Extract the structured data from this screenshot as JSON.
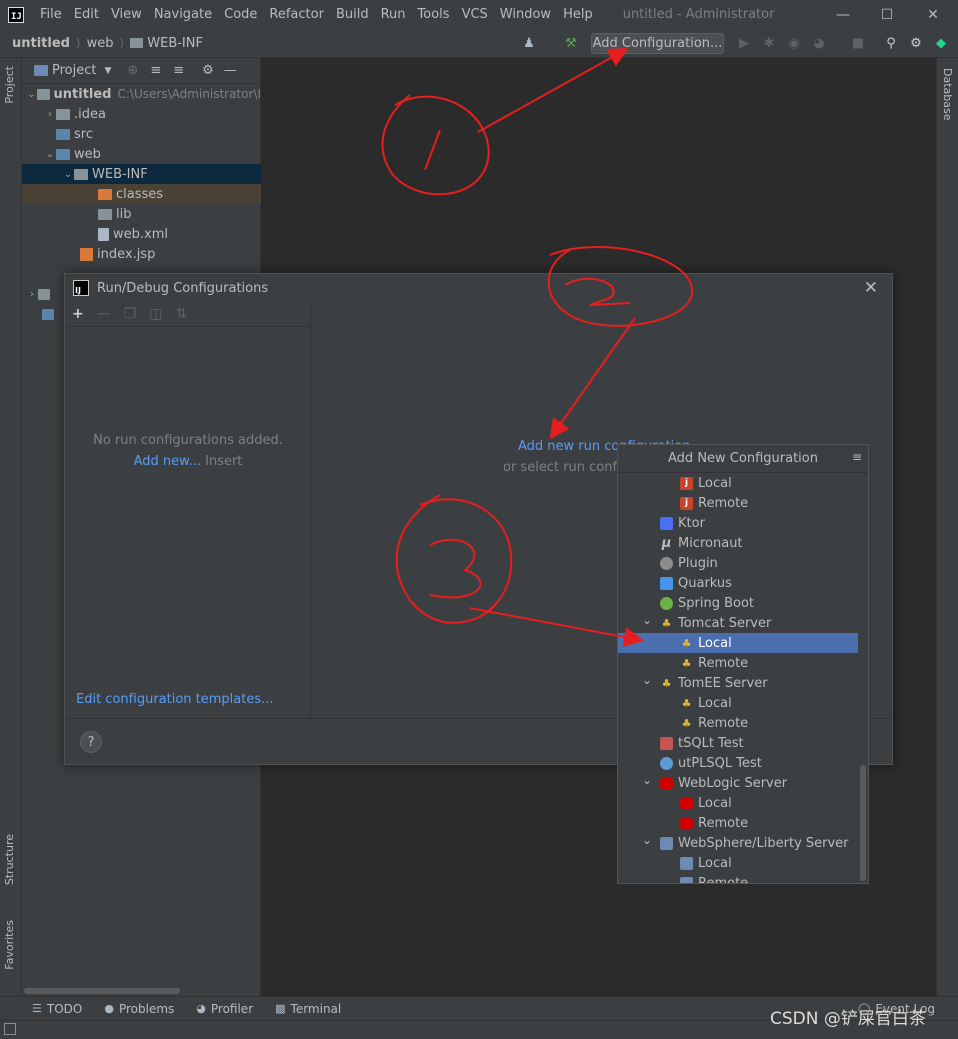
{
  "menubar": {
    "logo": "IJ",
    "items": [
      "File",
      "Edit",
      "View",
      "Navigate",
      "Code",
      "Refactor",
      "Build",
      "Run",
      "Tools",
      "VCS",
      "Window",
      "Help"
    ],
    "window_title": "untitled - Administrator"
  },
  "navbar": {
    "crumbs": [
      "untitled",
      "web",
      "WEB-INF"
    ],
    "add_config_label": "Add Configuration..."
  },
  "left_strip": {
    "project_tab": "Project",
    "structure_tab": "Structure",
    "favorites_tab": "Favorites"
  },
  "right_strip": {
    "database_tab": "Database"
  },
  "project_panel": {
    "header": "Project",
    "root": {
      "label": "untitled",
      "path": "C:\\Users\\Administrator\\I"
    },
    "items": [
      ".idea",
      "src",
      "web",
      "WEB-INF",
      "classes",
      "lib",
      "web.xml",
      "index.jsp"
    ]
  },
  "dialog": {
    "title": "Run/Debug Configurations",
    "empty_text": "No run configurations added.",
    "add_new_link": "Add new...",
    "add_new_hint": "Insert",
    "edit_templates": "Edit configuration templates...",
    "right_link": "Add new run configuration...",
    "right_hint": "or select run configuration template",
    "help": "?"
  },
  "popup": {
    "title": "Add New Configuration",
    "rows": [
      {
        "label": "Local",
        "indent": 2,
        "icon": "remote-java-icon",
        "sel": false
      },
      {
        "label": "Remote",
        "indent": 2,
        "icon": "remote-java-icon",
        "sel": false
      },
      {
        "label": "Ktor",
        "indent": 1,
        "icon": "ktor-icon",
        "sel": false
      },
      {
        "label": "Micronaut",
        "indent": 1,
        "icon": "micronaut-icon",
        "sel": false
      },
      {
        "label": "Plugin",
        "indent": 1,
        "icon": "plugin-icon",
        "sel": false
      },
      {
        "label": "Quarkus",
        "indent": 1,
        "icon": "quarkus-icon",
        "sel": false
      },
      {
        "label": "Spring Boot",
        "indent": 1,
        "icon": "spring-boot-icon",
        "sel": false
      },
      {
        "label": "Tomcat Server",
        "indent": 1,
        "icon": "tomcat-icon",
        "sel": false,
        "expanded": true
      },
      {
        "label": "Local",
        "indent": 2,
        "icon": "tomcat-icon",
        "sel": true
      },
      {
        "label": "Remote",
        "indent": 2,
        "icon": "tomcat-icon",
        "sel": false
      },
      {
        "label": "TomEE Server",
        "indent": 1,
        "icon": "tomcat-icon",
        "sel": false,
        "expanded": true
      },
      {
        "label": "Local",
        "indent": 2,
        "icon": "tomcat-icon",
        "sel": false
      },
      {
        "label": "Remote",
        "indent": 2,
        "icon": "tomcat-icon",
        "sel": false
      },
      {
        "label": "tSQLt Test",
        "indent": 1,
        "icon": "tsqlt-icon",
        "sel": false
      },
      {
        "label": "utPLSQL Test",
        "indent": 1,
        "icon": "utplsql-icon",
        "sel": false
      },
      {
        "label": "WebLogic Server",
        "indent": 1,
        "icon": "weblogic-icon",
        "sel": false,
        "expanded": true
      },
      {
        "label": "Local",
        "indent": 2,
        "icon": "weblogic-icon",
        "sel": false
      },
      {
        "label": "Remote",
        "indent": 2,
        "icon": "weblogic-icon",
        "sel": false
      },
      {
        "label": "WebSphere/Liberty Server",
        "indent": 1,
        "icon": "websphere-icon",
        "sel": false,
        "expanded": true
      },
      {
        "label": "Local",
        "indent": 2,
        "icon": "websphere-icon",
        "sel": false
      },
      {
        "label": "Remote",
        "indent": 2,
        "icon": "websphere-icon",
        "sel": false
      }
    ]
  },
  "bottombar": {
    "items": [
      "TODO",
      "Problems",
      "Profiler",
      "Terminal"
    ],
    "event_log": "Event Log"
  },
  "watermark": "CSDN @铲屎官白茶",
  "annotations": {
    "colors": {
      "ink": "#e81e1e"
    }
  }
}
